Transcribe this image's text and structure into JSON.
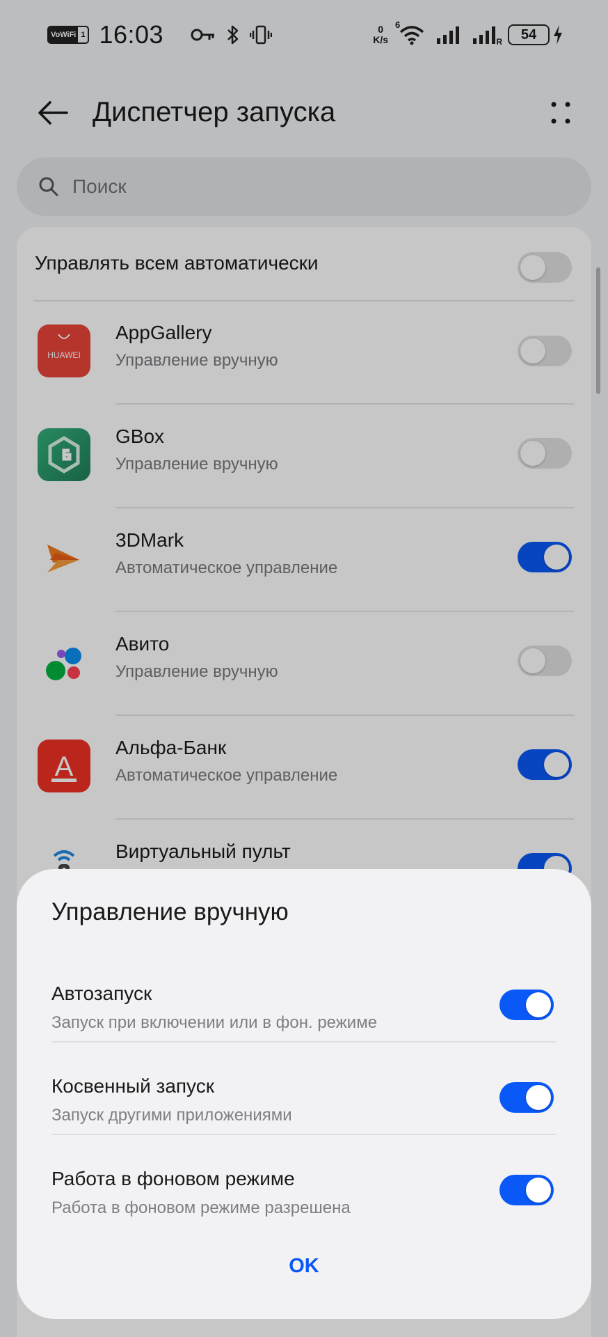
{
  "status_bar": {
    "vowifi_a": "VoWiFi",
    "vowifi_b": "1",
    "time": "16:03",
    "net_speed_value": "0",
    "net_speed_unit": "K/s",
    "wifi_badge": "6",
    "roaming_badge": "R",
    "battery": "54"
  },
  "app_bar": {
    "title": "Диспетчер запуска"
  },
  "search": {
    "placeholder": "Поиск"
  },
  "manage_all": {
    "label": "Управлять всем автоматически",
    "enabled": false
  },
  "apps": [
    {
      "name": "AppGallery",
      "mode": "Управление вручную",
      "enabled": false,
      "icon": "huawei-appgallery-icon",
      "icon_text": "HUAWEI"
    },
    {
      "name": "GBox",
      "mode": "Управление вручную",
      "enabled": false,
      "icon": "gbox-icon"
    },
    {
      "name": "3DMark",
      "mode": "Автоматическое управление",
      "enabled": true,
      "icon": "3dmark-icon"
    },
    {
      "name": "Авито",
      "mode": "Управление вручную",
      "enabled": false,
      "icon": "avito-icon"
    },
    {
      "name": "Альфа-Банк",
      "mode": "Автоматическое управление",
      "enabled": true,
      "icon": "alfa-bank-icon",
      "icon_text": "А"
    },
    {
      "name": "Виртуальный пульт",
      "mode": "",
      "enabled": true,
      "icon": "virtual-remote-icon"
    }
  ],
  "sheet": {
    "title": "Управление вручную",
    "options": [
      {
        "title": "Автозапуск",
        "subtitle": "Запуск при включении или в фон. режиме",
        "enabled": true
      },
      {
        "title": "Косвенный запуск",
        "subtitle": "Запуск другими приложениями",
        "enabled": true
      },
      {
        "title": "Работа в фоновом режиме",
        "subtitle": "Работа в фоновом режиме разрешена",
        "enabled": true
      }
    ],
    "ok_label": "OK"
  },
  "colors": {
    "accent": "#0a59f7",
    "background": "#f1f3f5",
    "huawei_red": "#e8443a",
    "alfa_red": "#ef3124",
    "gbox_green": "#2b9a6a"
  }
}
